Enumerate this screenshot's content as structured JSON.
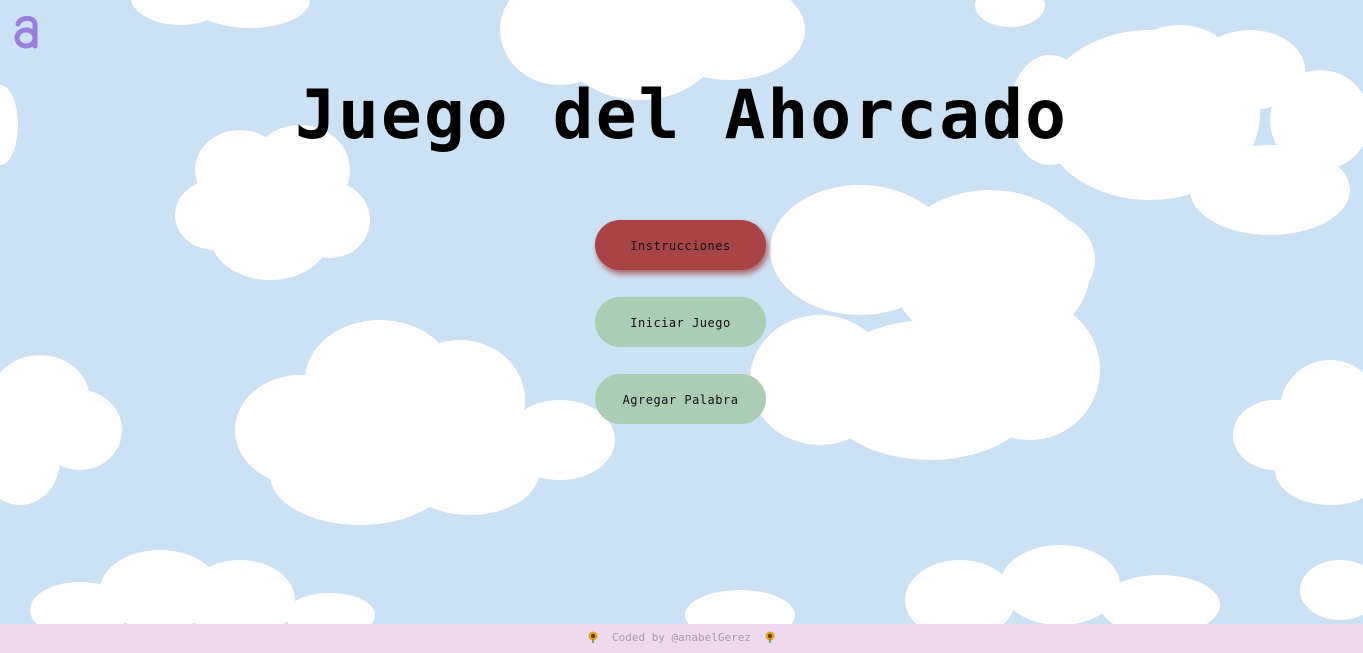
{
  "app": {
    "title": "Juego del Ahorcado",
    "logo_letter": "a",
    "logo_color": "#9b7fdc"
  },
  "menu": {
    "instructions_label": "Instrucciones",
    "start_label": "Iniciar Juego",
    "add_word_label": "Agregar Palabra"
  },
  "colors": {
    "sky": "#cde1f5",
    "active_button": "#a94446",
    "button": "#acccb3",
    "footer_bg": "#efd9ef"
  },
  "footer": {
    "text": "Coded by @anabelGerez",
    "icon": "sunflower-icon"
  }
}
